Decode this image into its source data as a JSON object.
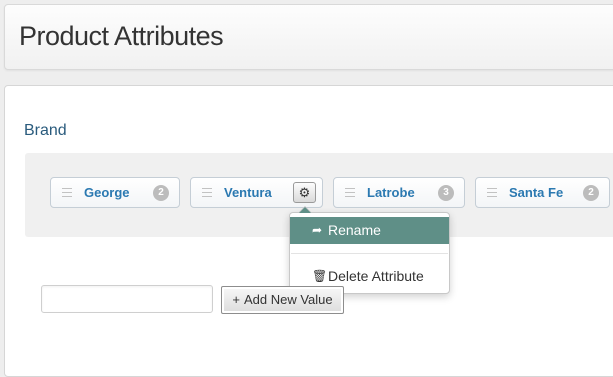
{
  "header": {
    "title": "Product Attributes"
  },
  "attribute": {
    "name": "Brand",
    "values": [
      {
        "label": "George",
        "count": "2"
      },
      {
        "label": "Ventura",
        "count": ""
      },
      {
        "label": "Latrobe",
        "count": "3"
      },
      {
        "label": "Santa Fe",
        "count": "2"
      }
    ]
  },
  "context_menu": {
    "rename_label": "Rename",
    "rename_icon": "share-arrow-icon",
    "delete_label": "Delete Attribute",
    "delete_icon": "trash-icon",
    "accent_color": "#5f8f87"
  },
  "add_value": {
    "input_value": "",
    "placeholder": "",
    "button_label": "Add New Value",
    "button_icon": "plus-icon"
  },
  "icons": {
    "settings": "gear-icon",
    "drag": "drag-handle-icon"
  },
  "colors": {
    "value_text": "#2b79b1",
    "heading": "#2a5b7d",
    "badge": "#bcbcbc"
  }
}
